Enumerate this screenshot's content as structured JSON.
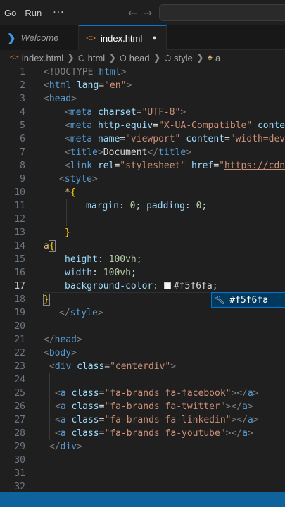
{
  "menubar": {
    "items": [
      "Go",
      "Run"
    ],
    "more": "···",
    "back_icon": "←",
    "forward_icon": "→"
  },
  "tabs": [
    {
      "label": "Welcome",
      "icon": "vscode-logo-icon",
      "active": false
    },
    {
      "label": "index.html",
      "icon": "html-file-icon",
      "active": true,
      "dirty": true
    }
  ],
  "breadcrumb": [
    "index.html",
    "html",
    "head",
    "style",
    "a"
  ],
  "editor": {
    "current_line": 17,
    "lines": [
      1,
      2,
      3,
      4,
      5,
      6,
      7,
      8,
      9,
      10,
      11,
      12,
      13,
      14,
      15,
      16,
      17,
      18,
      19,
      20,
      21,
      22,
      23,
      24,
      25,
      26,
      27,
      28,
      29,
      30,
      31,
      32
    ],
    "code": {
      "l1": [
        "<!DOCTYPE",
        "html",
        ">"
      ],
      "l2": [
        "<",
        "html",
        "lang",
        "=",
        "\"en\"",
        ">"
      ],
      "l3": [
        "<",
        "head",
        ">"
      ],
      "l4": [
        "<",
        "meta",
        "charset",
        "=",
        "\"UTF-8\"",
        ">"
      ],
      "l5": [
        "<",
        "meta",
        "http-equiv",
        "=",
        "\"X-UA-Compatible\"",
        "conten"
      ],
      "l6": [
        "<",
        "meta",
        "name",
        "=",
        "\"viewport\"",
        "content",
        "=",
        "\"width=devi"
      ],
      "l7": [
        "<",
        "title",
        ">",
        "Document",
        "</",
        "title",
        ">"
      ],
      "l8": [
        "<",
        "link",
        "rel",
        "=",
        "\"stylesheet\"",
        "href",
        "=",
        "\"",
        "https://cdnj"
      ],
      "l9": [
        "<",
        "style",
        ">"
      ],
      "l10": [
        "*",
        "{"
      ],
      "l11": [
        "margin",
        ": ",
        "0",
        "; ",
        "padding",
        ": ",
        "0",
        ";"
      ],
      "l13": [
        "}"
      ],
      "l14": [
        "a",
        "{"
      ],
      "l15": [
        "height",
        ": ",
        "100vh",
        ";"
      ],
      "l16": [
        "width",
        ": ",
        "100vh",
        ";"
      ],
      "l17": [
        "background-color",
        ": ",
        "#f5f6fa",
        ";"
      ],
      "l18": [
        "}"
      ],
      "l19": [
        "</",
        "style",
        ">"
      ],
      "l21": [
        "</",
        "head",
        ">"
      ],
      "l22": [
        "<",
        "body",
        ">"
      ],
      "l23": [
        "<",
        "div",
        "class",
        "=",
        "\"centerdiv\"",
        ">"
      ],
      "l25": [
        "<",
        "a",
        "class",
        "=",
        "\"fa-brands fa-facebook\"",
        "></",
        "a",
        ">"
      ],
      "l26": [
        "<",
        "a",
        "class",
        "=",
        "\"fa-brands fa-twitter\"",
        "></",
        "a",
        ">"
      ],
      "l27": [
        "<",
        "a",
        "class",
        "=",
        "\"fa-brands fa-linkedin\"",
        "></",
        "a",
        ">"
      ],
      "l28": [
        "<",
        "a",
        "class",
        "=",
        "\"fa-brands fa-youtube\"",
        "></",
        "a",
        ">"
      ],
      "l29": [
        "</",
        "div",
        ">"
      ]
    }
  },
  "suggestion": {
    "label": "#f5f6fa",
    "icon": "wrench-icon"
  },
  "colors": {
    "accent": "#0078d4",
    "swatch": "#f5f6fa",
    "statusbar": "#0e639c"
  }
}
